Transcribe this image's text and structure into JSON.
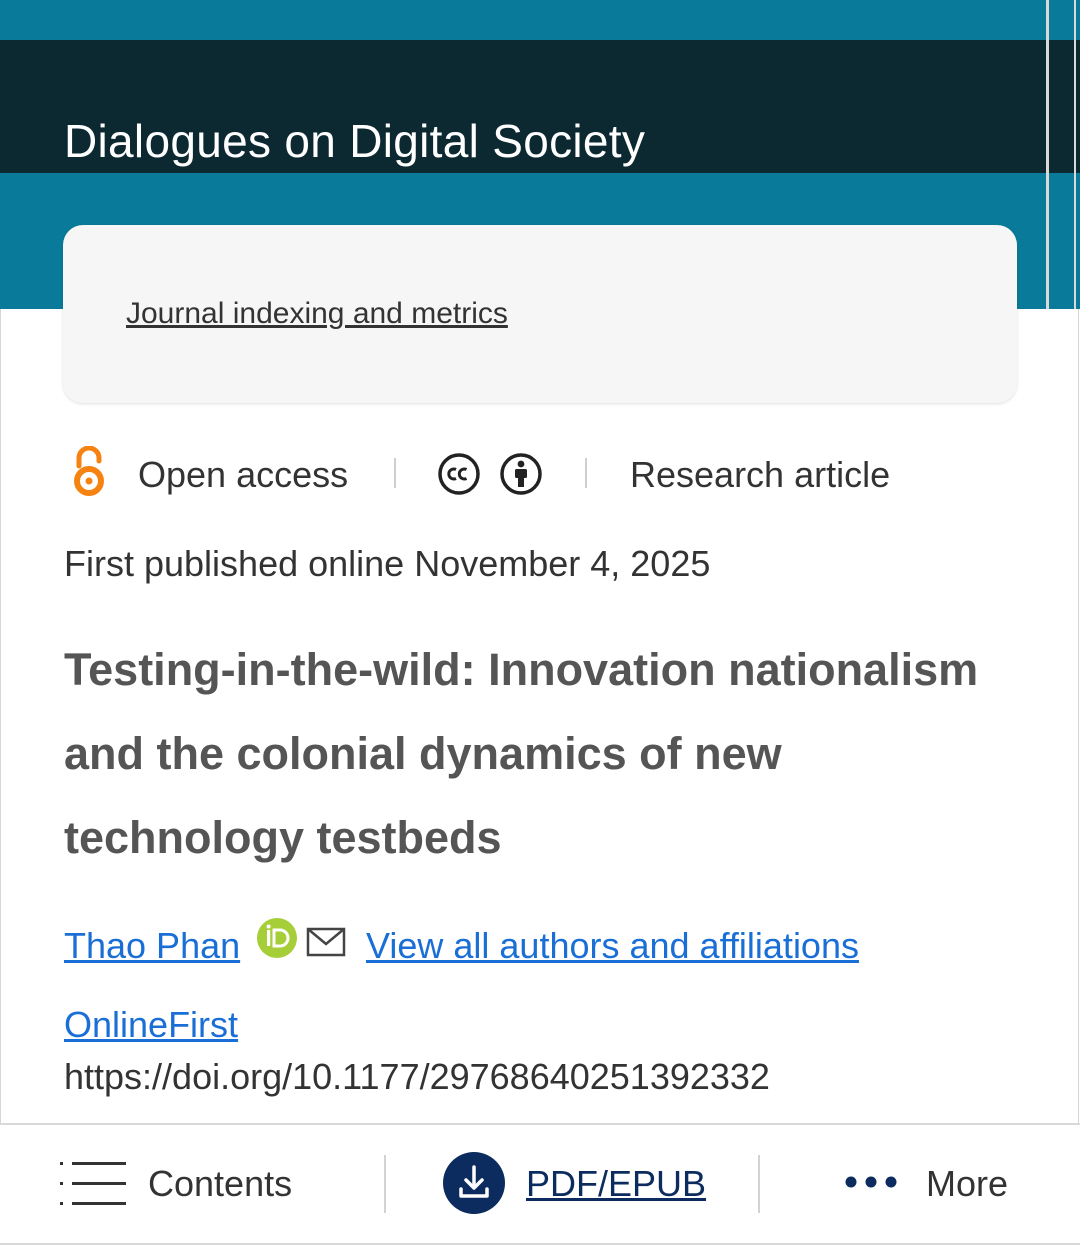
{
  "header": {
    "journal_title": "Dialogues on Digital Society"
  },
  "card": {
    "link_label": "Journal indexing and metrics"
  },
  "meta": {
    "open_access_label": "Open access",
    "license_icons": [
      "creative-commons-icon",
      "attribution-icon"
    ],
    "article_type": "Research article",
    "published": "First published online November 4, 2025"
  },
  "article": {
    "title": "Testing-in-the-wild: Innovation nationalism and the colonial dynamics of new technology testbeds",
    "author": "Thao Phan",
    "all_authors_link": "View all authors and affiliations",
    "issue_link": "OnlineFirst",
    "doi": "https://doi.org/10.1177/29768640251392332"
  },
  "bottom_bar": {
    "contents_label": "Contents",
    "pdf_label": "PDF/EPUB",
    "more_label": "More"
  },
  "colors": {
    "brand_teal": "#0a7a9a",
    "header_dark": "#0c2932",
    "open_access_orange": "#f68212",
    "link_blue": "#1a6fd6",
    "orcid_green": "#a6ce39",
    "pdf_navy": "#0c2b5e"
  }
}
